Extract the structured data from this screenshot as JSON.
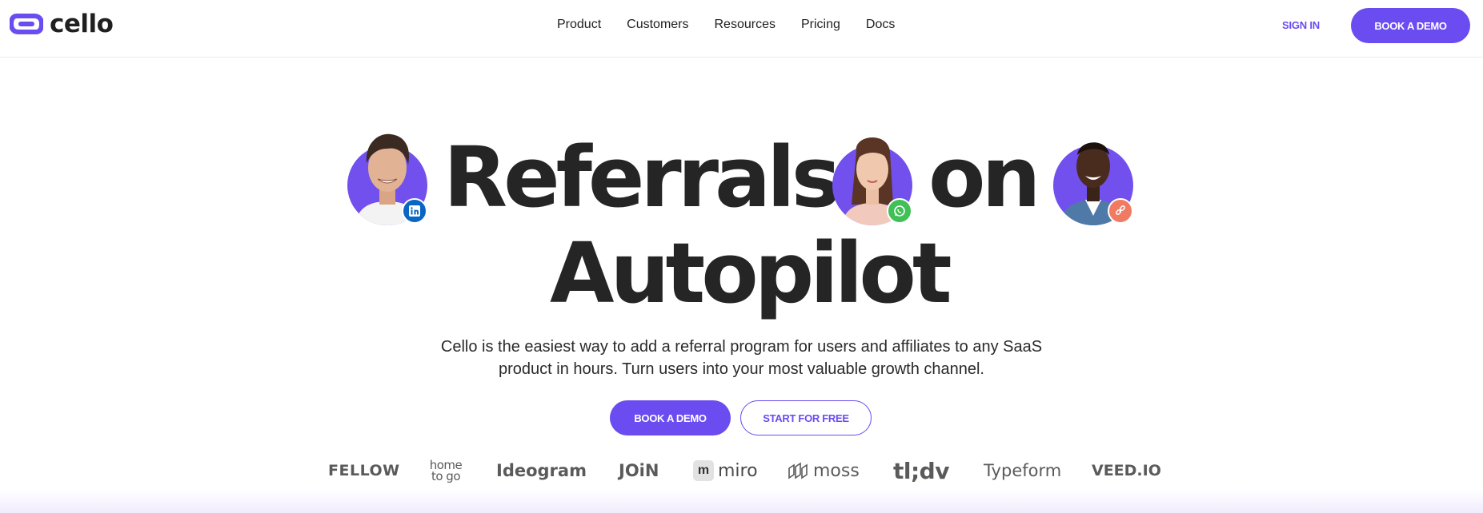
{
  "brand": {
    "name": "cello",
    "accent": "#6b4cf0"
  },
  "nav": {
    "items": [
      "Product",
      "Customers",
      "Resources",
      "Pricing",
      "Docs"
    ]
  },
  "header": {
    "sign_in": "SIGN IN",
    "book_demo": "BOOK A DEMO"
  },
  "hero": {
    "headline_part1": "Referrals",
    "headline_part2": "on",
    "headline_part3": "Autopilot",
    "subtitle": "Cello is the easiest way to add a referral program for users and affiliates to any SaaS product in hours. Turn users into your most valuable growth channel.",
    "primary_cta": "BOOK A DEMO",
    "secondary_cta": "START FOR FREE",
    "avatars": [
      {
        "badge": "linkedin-icon"
      },
      {
        "badge": "whatsapp-icon"
      },
      {
        "badge": "link-icon"
      }
    ]
  },
  "customer_logos": [
    "FELLOW",
    "home to go",
    "Ideogram",
    "JOiN",
    "miro",
    "moss",
    "tl;dv",
    "Typeform",
    "VEED.IO"
  ]
}
